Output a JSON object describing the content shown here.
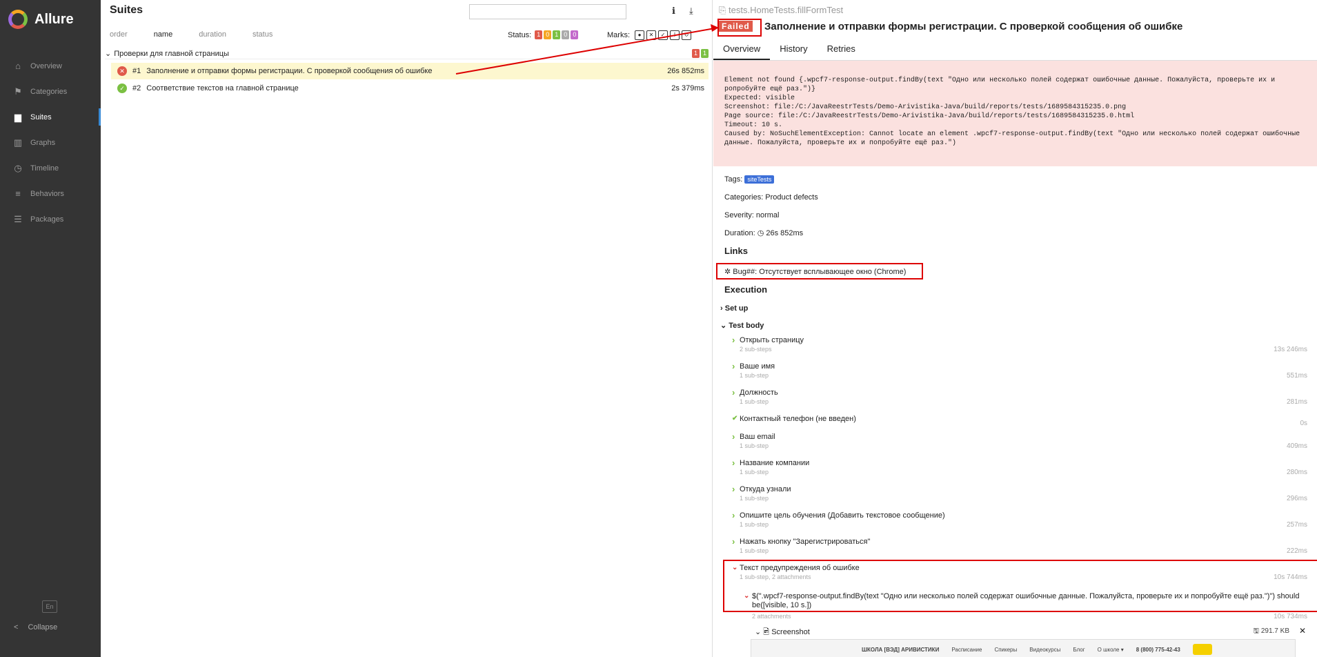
{
  "sidebar": {
    "brand": "Allure",
    "items": [
      {
        "label": "Overview",
        "icon": "home-icon",
        "glyph": "⌂"
      },
      {
        "label": "Categories",
        "icon": "flag-icon",
        "glyph": "⚑"
      },
      {
        "label": "Suites",
        "icon": "briefcase-icon",
        "glyph": "▆"
      },
      {
        "label": "Graphs",
        "icon": "bar-chart-icon",
        "glyph": "▥"
      },
      {
        "label": "Timeline",
        "icon": "clock-icon",
        "glyph": "◷"
      },
      {
        "label": "Behaviors",
        "icon": "list-icon",
        "glyph": "≡"
      },
      {
        "label": "Packages",
        "icon": "stack-icon",
        "glyph": "☰"
      }
    ],
    "lang": "En",
    "collapse": "Collapse"
  },
  "suites": {
    "title": "Suites",
    "sort": [
      "order",
      "name",
      "duration",
      "status"
    ],
    "status_label": "Status:",
    "status_counts": [
      {
        "v": "1",
        "c": "#e05a4a"
      },
      {
        "v": "0",
        "c": "#f5a623"
      },
      {
        "v": "1",
        "c": "#7bc043"
      },
      {
        "v": "0",
        "c": "#aaaaaa"
      },
      {
        "v": "0",
        "c": "#c36acb"
      }
    ],
    "marks_label": "Marks:",
    "group": {
      "name": "Проверки для главной страницы",
      "failed": "1",
      "passed": "1"
    },
    "rows": [
      {
        "num": "#1",
        "name": "Заполнение и отправки формы регистрации. С проверкой сообщения об ошибке",
        "dur": "26s 852ms",
        "status": "failed"
      },
      {
        "num": "#2",
        "name": "Соответствие текстов на главной странице",
        "dur": "2s 379ms",
        "status": "passed"
      }
    ]
  },
  "detail": {
    "crumb": "tests.HomeTests.fillFormTest",
    "status": "Failed",
    "title": "Заполнение и отправки формы регистрации. С проверкой сообщения об ошибке",
    "tabs": [
      "Overview",
      "History",
      "Retries"
    ],
    "error": "Element not found {.wpcf7-response-output.findBy(text \"Одно или несколько полей содержат ошибочные данные. Пожалуйста, проверьте их и\npопробуйте ещё раз.\")}\nExpected: visible\nScreenshot: file:/C:/JavaReestrTests/Demo-Arivistika-Java/build/reports/tests/1689584315235.0.png\nPage source: file:/C:/JavaReestrTests/Demo-Arivistika-Java/build/reports/tests/1689584315235.0.html\nTimeout: 10 s.\nCaused by: NoSuchElementException: Cannot locate an element .wpcf7-response-output.findBy(text \"Одно или несколько полей содержат ошибочные\nданные. Пожалуйста, проверьте их и попробуйте ещё раз.\")",
    "tags_label": "Tags:",
    "tag": "siteTests",
    "categories": "Categories: Product defects",
    "severity": "Severity: normal",
    "duration_label": "Duration:",
    "duration": "26s 852ms",
    "links_h": "Links",
    "link": "Bug##: Отсутствует всплывающее окно (Chrome)",
    "exec_h": "Execution",
    "setup": "Set up",
    "body": "Test body",
    "steps": [
      {
        "name": "Открыть страницу",
        "sub": "2 sub-steps",
        "tm": "13s 246ms"
      },
      {
        "name": "Ваше имя",
        "sub": "1 sub-step",
        "tm": "551ms"
      },
      {
        "name": "Должность",
        "sub": "1 sub-step",
        "tm": "281ms"
      },
      {
        "name": "Контактный телефон (не введен)",
        "sub": "",
        "tm": "0s"
      },
      {
        "name": "Ваш email",
        "sub": "1 sub-step",
        "tm": "409ms"
      },
      {
        "name": "Название компании",
        "sub": "1 sub-step",
        "tm": "280ms"
      },
      {
        "name": "Откуда узнали",
        "sub": "1 sub-step",
        "tm": "296ms"
      },
      {
        "name": "Опишите цель обучения (Добавить текстовое сообщение)",
        "sub": "1 sub-step",
        "tm": "257ms"
      },
      {
        "name": "Нажать кнопку \"Зарегистрироваться\"",
        "sub": "1 sub-step",
        "tm": "222ms"
      },
      {
        "name": "Текст предупреждения об ошибке",
        "sub": "1 sub-step, 2 attachments",
        "tm": "10s 744ms"
      }
    ],
    "substep": "$(\".wpcf7-response-output.findBy(text \"Одно или несколько полей содержат ошибочные данные. Пожалуйста, проверьте их и попробуйте ещё раз.\")\") should be([visible, 10 s.])",
    "substep_sub": "2 attachments",
    "substep_tm": "10s 734ms",
    "attach": "Screenshot",
    "attach_size": "291.7 KB",
    "preview": {
      "school": "ШКОЛА [ВЭД] АРИВИСТИКИ",
      "menu": [
        "Расписание",
        "Спикеры",
        "Видеокурсы",
        "Блог",
        "О школе ▾"
      ],
      "phone": "8 (800) 775-42-43"
    }
  }
}
